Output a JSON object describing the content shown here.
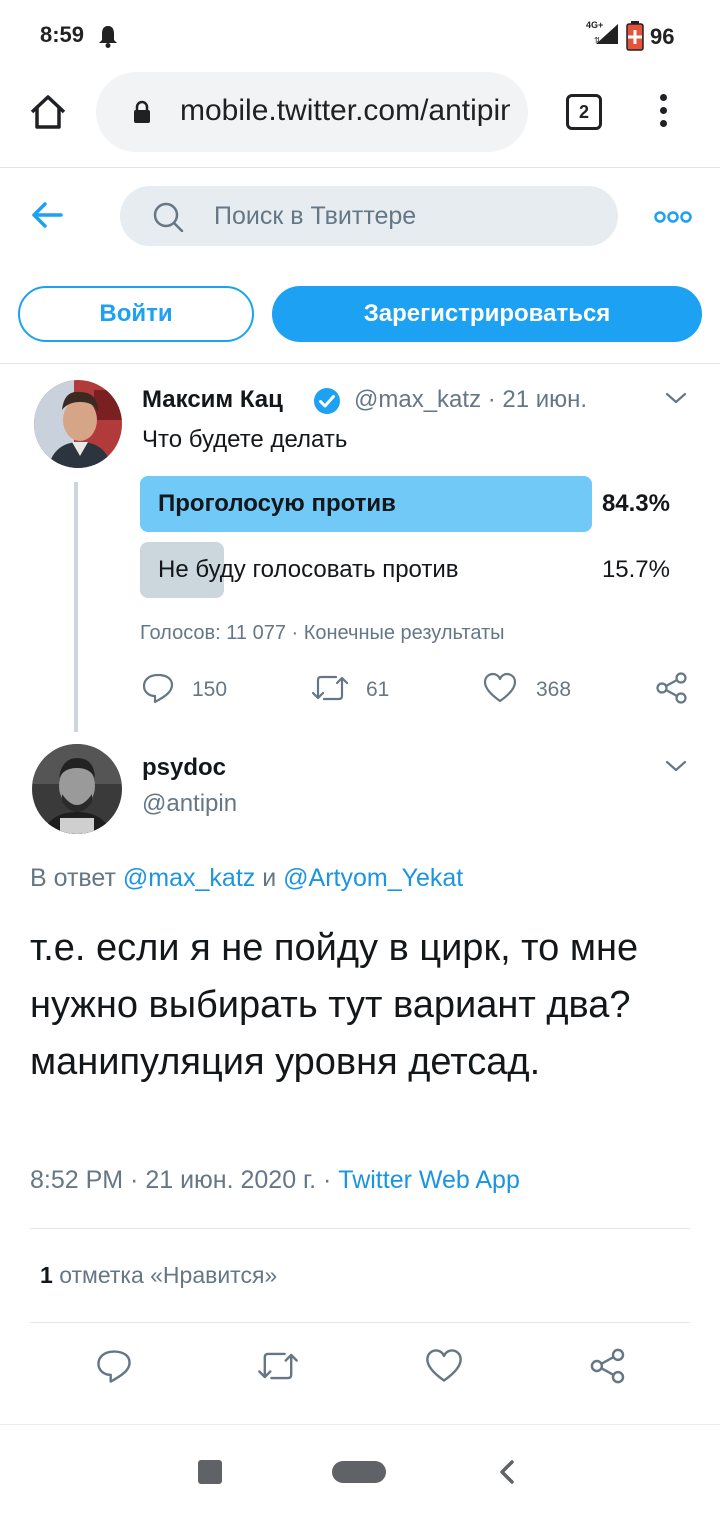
{
  "status_bar": {
    "time": "8:59",
    "network": "4G+",
    "battery": "96"
  },
  "browser": {
    "url": "mobile.twitter.com/antipin",
    "tab_count": "2"
  },
  "header": {
    "search_placeholder": "Поиск в Твиттере"
  },
  "auth": {
    "login_label": "Войти",
    "signup_label": "Зарегистрироваться"
  },
  "tweet1": {
    "name": "Максим Кац",
    "handle_date": "@max_katz · 21 июн.",
    "text": "Что будете делать",
    "poll": {
      "options": [
        {
          "label": "Проголосую против",
          "percent": "84.3%",
          "fraction": 0.843
        },
        {
          "label": "Не буду голосовать против",
          "percent": "15.7%",
          "fraction": 0.157
        }
      ],
      "meta": "Голосов: 11 077 · Конечные результаты"
    },
    "actions": {
      "replies": "150",
      "retweets": "61",
      "likes": "368"
    }
  },
  "tweet2": {
    "name": "psydoc",
    "handle": "@antipin",
    "reply_prefix": "В ответ",
    "reply_mention1": "@max_katz",
    "reply_and": "и",
    "reply_mention2": "@Artyom_Yekat",
    "text": "т.е. если я не пойду в цирк, то мне нужно выбирать тут вариант два? манипуляция уровня детсад.",
    "timestamp": "8:52 PM · 21 июн. 2020 г. ·",
    "source": "Twitter Web App",
    "likes_count": "1",
    "likes_label": "отметка «Нравится»"
  },
  "colors": {
    "accent": "#1da1f2",
    "poll_winner": "#71c9f8",
    "poll_other": "#ccd6dd",
    "secondary_text": "#657786"
  },
  "icons": [
    "bell-icon",
    "signal-icon",
    "battery-icon",
    "home-icon",
    "lock-icon",
    "back-arrow-icon",
    "search-icon",
    "more-icon",
    "verified-icon",
    "chevron-down-icon",
    "reply-icon",
    "retweet-icon",
    "like-icon",
    "share-icon"
  ]
}
